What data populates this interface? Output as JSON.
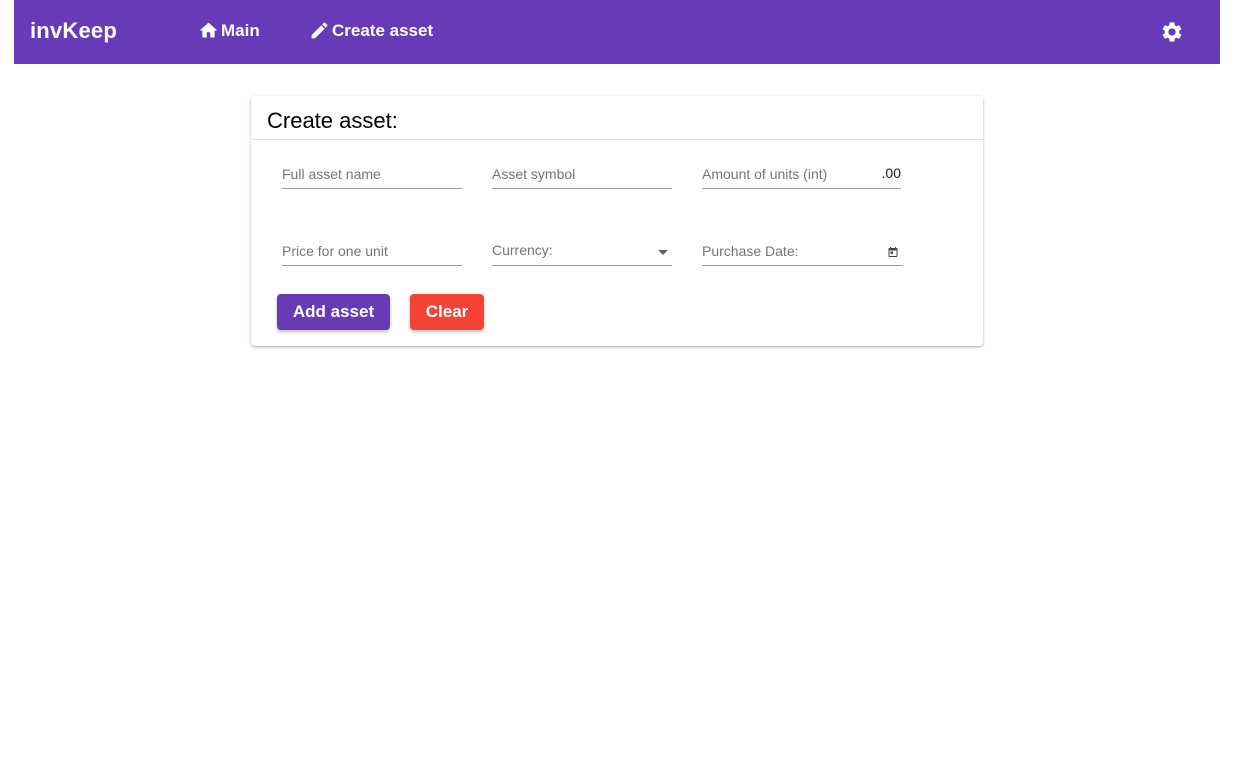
{
  "header": {
    "brand": "invKeep",
    "nav": [
      {
        "label": "Main",
        "icon": "home-icon"
      },
      {
        "label": "Create asset",
        "icon": "pencil-icon"
      }
    ],
    "settings_icon": "gear-icon",
    "background": "#673ab7"
  },
  "form": {
    "title": "Create asset:",
    "fields": {
      "name": {
        "placeholder": "Full asset name",
        "value": ""
      },
      "symbol": {
        "placeholder": "Asset symbol",
        "value": ""
      },
      "amount": {
        "placeholder": "Amount of units (int)",
        "value": "",
        "suffix": ".00"
      },
      "price": {
        "placeholder": "Price for one unit",
        "value": ""
      },
      "currency": {
        "label": "Currency:",
        "selected": ""
      },
      "purchase_date": {
        "placeholder": "Purchase Date:",
        "value": ""
      }
    },
    "buttons": {
      "add": "Add asset",
      "clear": "Clear"
    },
    "colors": {
      "primary": "#673ab7",
      "warn": "#f44336"
    }
  }
}
